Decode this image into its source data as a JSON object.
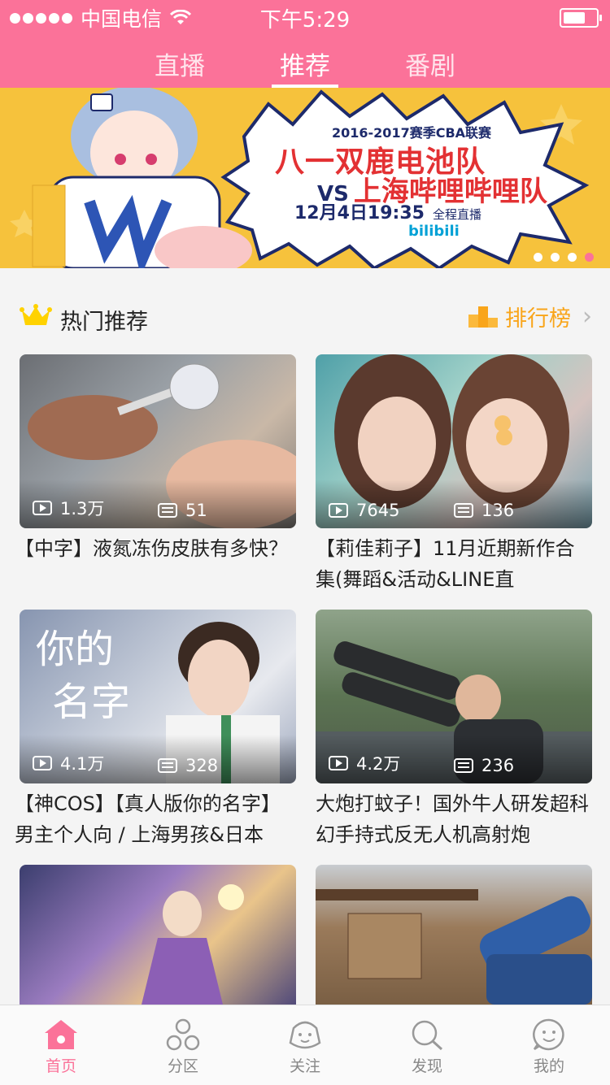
{
  "status_bar": {
    "carrier": "中国电信",
    "time": "下午5:29"
  },
  "header": {
    "tabs": [
      {
        "label": "直播",
        "active": false
      },
      {
        "label": "推荐",
        "active": true
      },
      {
        "label": "番剧",
        "active": false
      }
    ]
  },
  "banner": {
    "line1": "2016-2017赛季CBA联赛",
    "line2": "八一双鹿电池队",
    "vs": "VS",
    "line3": "上海哔哩哔哩队",
    "time": "12月4日19:35",
    "note": "全程直播",
    "logo": "bilibili",
    "pages": 4,
    "active_page": 4
  },
  "section": {
    "title": "热门推荐",
    "rank_label": "排行榜"
  },
  "videos": [
    {
      "plays": "1.3万",
      "danmaku": "51",
      "title": "【中字】液氮冻伤皮肤有多快？"
    },
    {
      "plays": "7645",
      "danmaku": "136",
      "title": "【莉佳莉子】11月近期新作合集(舞蹈&活动&LINE直"
    },
    {
      "plays": "4.1万",
      "danmaku": "328",
      "title": "【神COS】【真人版你的名字】男主个人向 / 上海男孩&日本"
    },
    {
      "plays": "4.2万",
      "danmaku": "236",
      "title": "大炮打蚊子！国外牛人研发超科幻手持式反无人机高射炮"
    }
  ],
  "bottom_nav": [
    {
      "label": "首页",
      "icon": "home-icon",
      "active": true
    },
    {
      "label": "分区",
      "icon": "category-icon",
      "active": false
    },
    {
      "label": "关注",
      "icon": "follow-icon",
      "active": false
    },
    {
      "label": "发现",
      "icon": "search-icon",
      "active": false
    },
    {
      "label": "我的",
      "icon": "profile-icon",
      "active": false
    }
  ],
  "colors": {
    "brand": "#fb7299",
    "rank": "#f9a51a"
  }
}
